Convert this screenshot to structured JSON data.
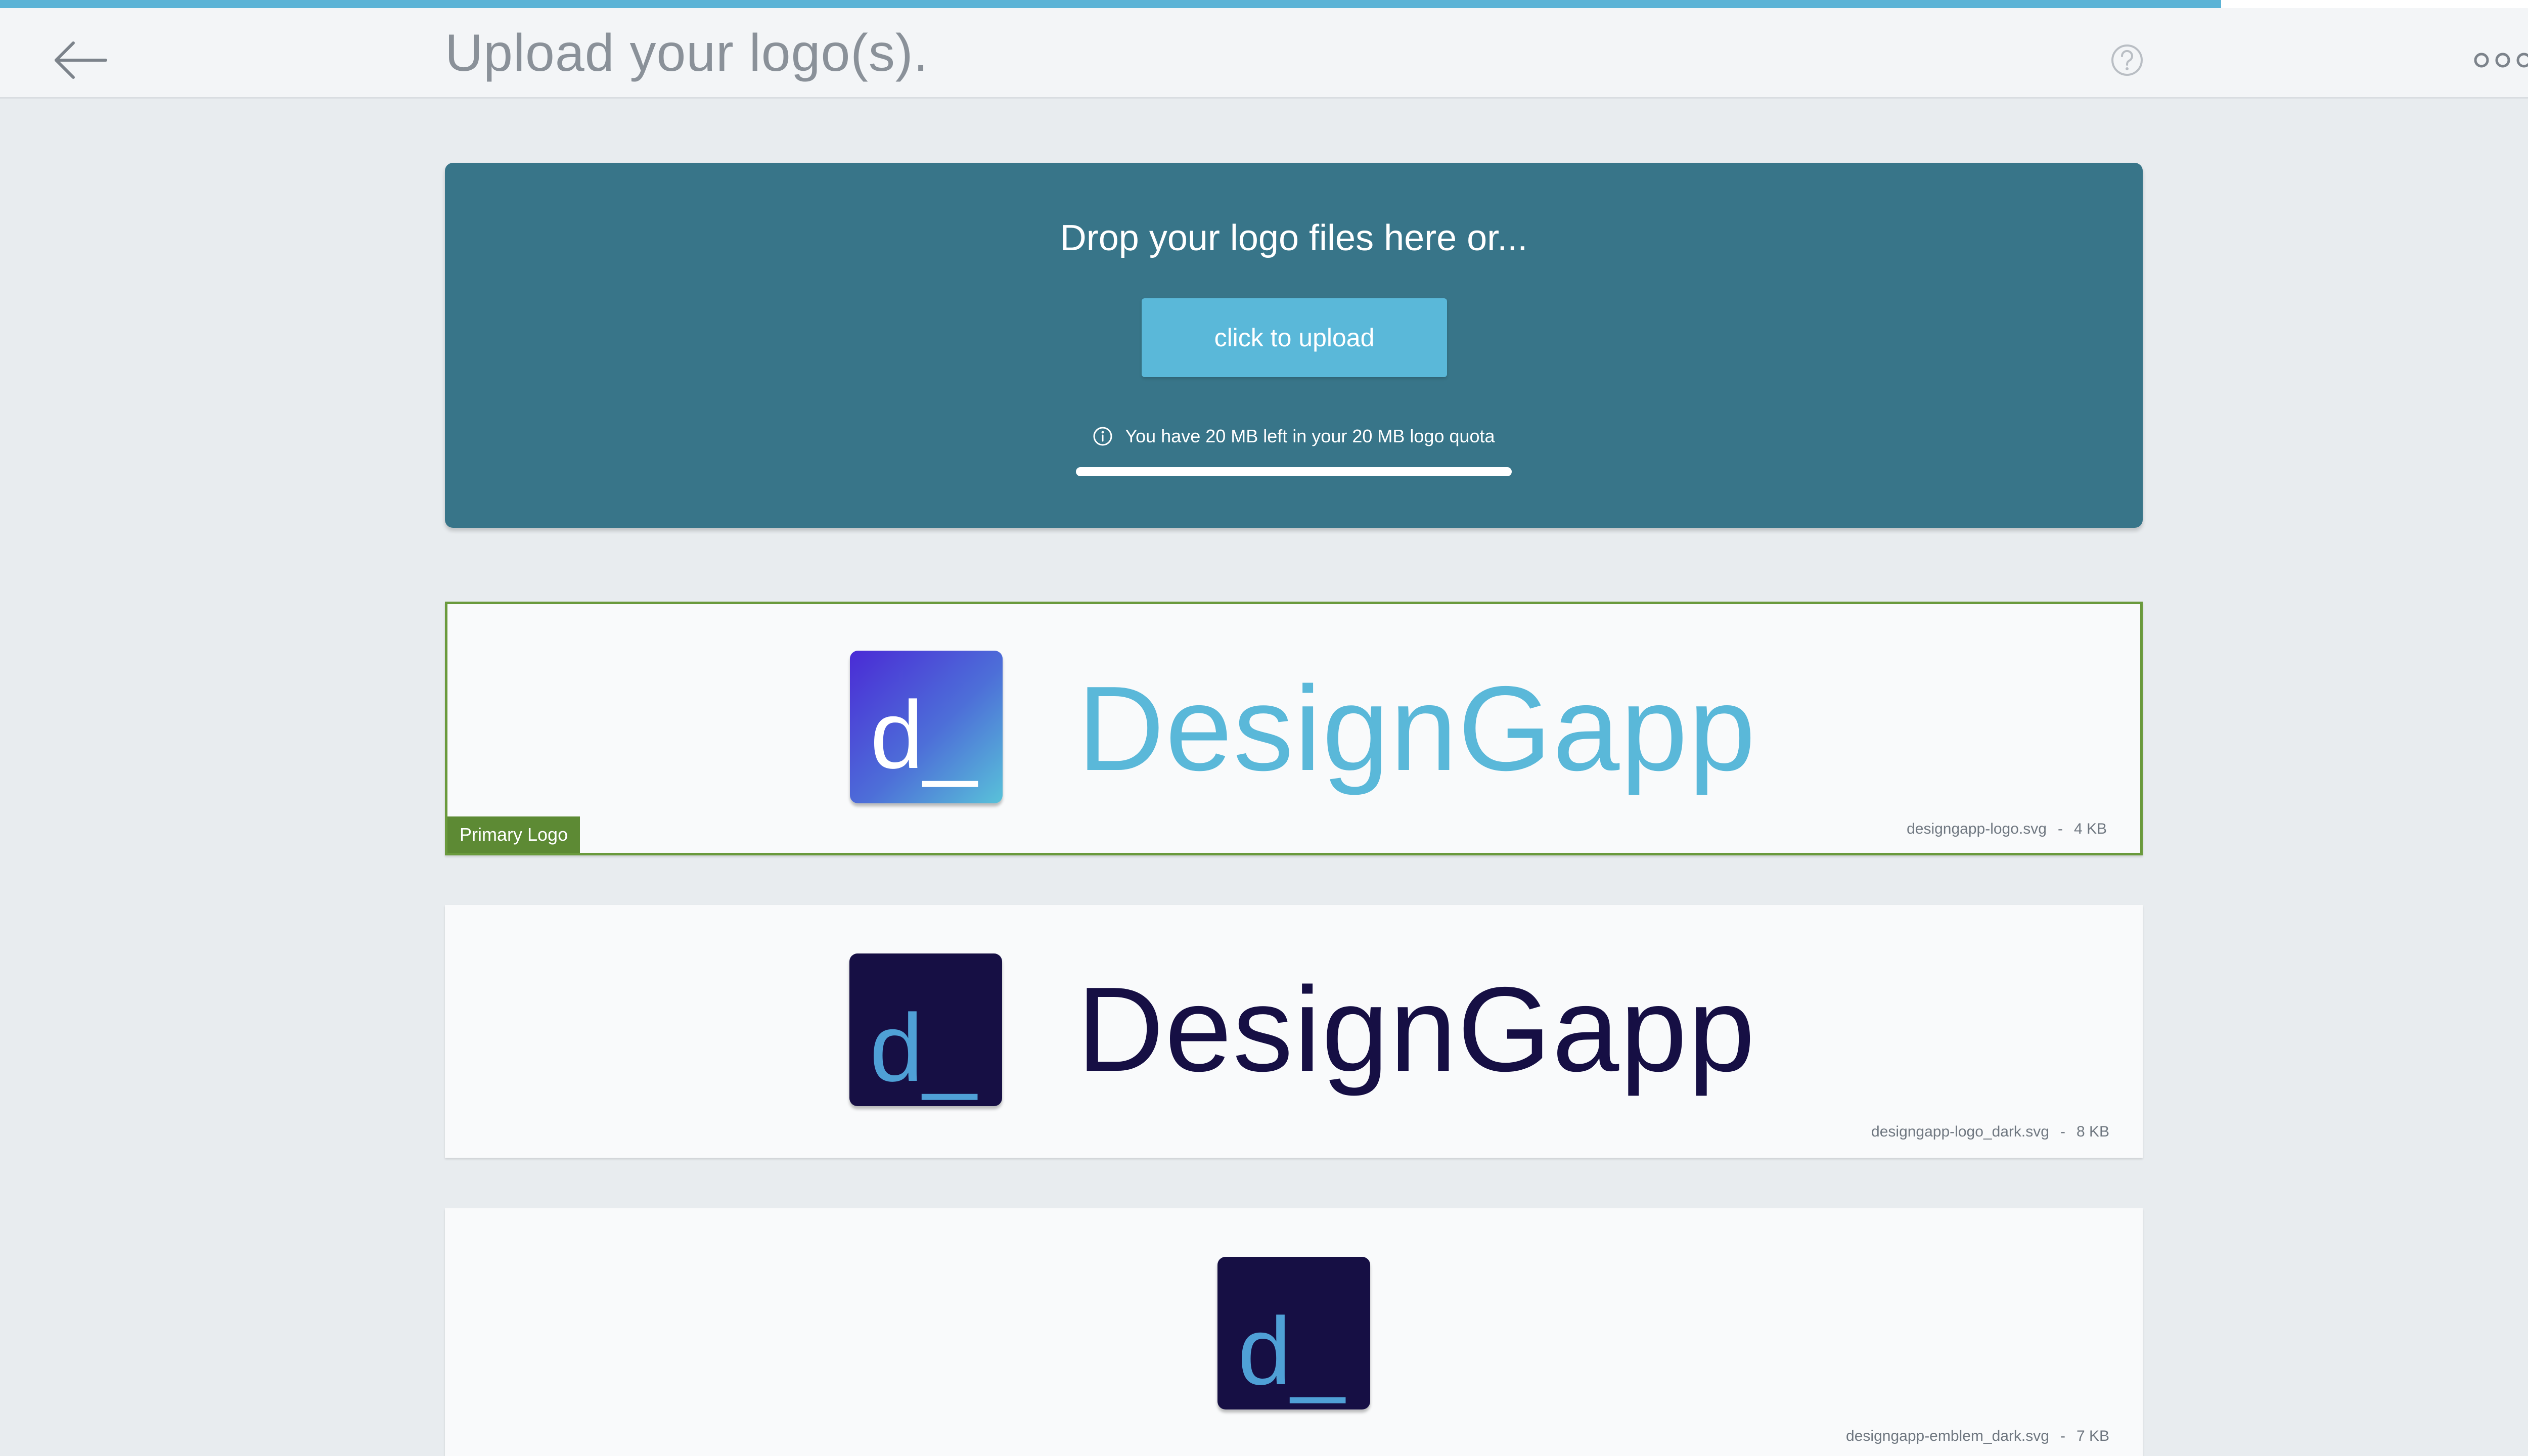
{
  "header": {
    "title": "Upload your logo(s).",
    "progress_fraction": 0.858,
    "back_icon": "arrow-left-icon",
    "help_icon": "question-circle-icon",
    "more_icon": "more-horizontal-icon"
  },
  "dropzone": {
    "prompt": "Drop your logo files here or...",
    "upload_label": "click to upload",
    "quota_text": "You have 20 MB left in your 20 MB logo quota",
    "quota_used_fraction": 0,
    "bg_color": "#387589",
    "button_color": "#5ab8d9"
  },
  "logos": [
    {
      "wordmark": "DesignGapp",
      "emblem_letter": "d_",
      "filename": "designgapp-logo.svg",
      "separator": "-",
      "size": "4 KB",
      "badge": "Primary Logo",
      "wordmark_color": "#5ab8d9"
    },
    {
      "wordmark": "DesignGapp",
      "emblem_letter": "d_",
      "filename": "designgapp-logo_dark.svg",
      "separator": "-",
      "size": "8 KB",
      "wordmark_color": "#160f44"
    },
    {
      "emblem_letter": "d_",
      "filename": "designgapp-emblem_dark.svg",
      "separator": "-",
      "size": "7 KB"
    }
  ]
}
